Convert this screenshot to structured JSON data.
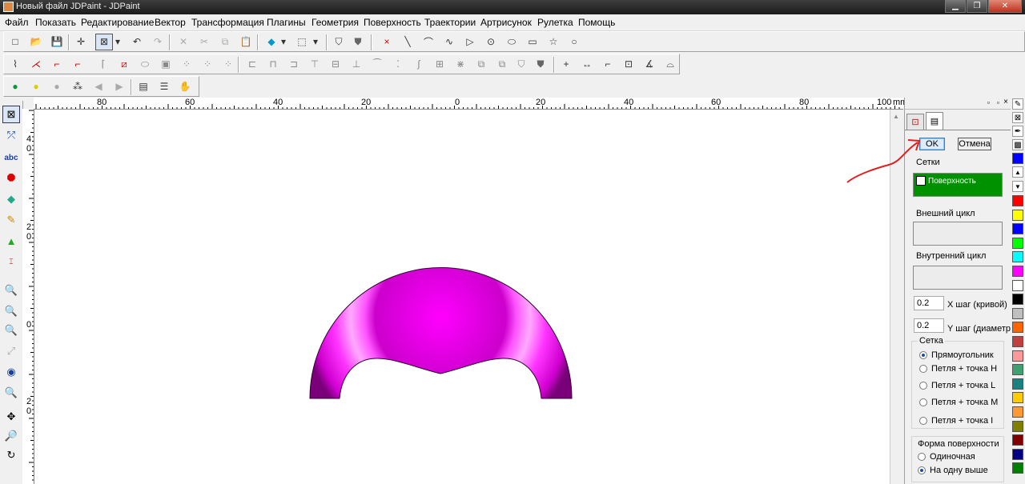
{
  "window": {
    "title": "Новый файл JDPaint - JDPaint",
    "minimize": "▁",
    "restore": "❐",
    "close": "✕"
  },
  "menu": [
    "Файл",
    "Показать",
    "Редактирование",
    "Вектор",
    "Трансформация",
    "Плагины",
    "Геометрия",
    "Поверхность",
    "Траектории",
    "Артрисунок",
    "Рулетка",
    "Помощь"
  ],
  "ruler": {
    "top_labels": [
      "80",
      "60",
      "40",
      "20",
      "0",
      "20",
      "40",
      "60",
      "80",
      "100",
      "mm"
    ],
    "left_labels": [
      "4",
      "0",
      "2",
      "0",
      "0",
      "2",
      "0"
    ]
  },
  "panel": {
    "ok_label": "OK",
    "cancel_label": "Отмена",
    "grids_label": "Сетки",
    "grid_item": "Поверхность",
    "outer_cycle_label": "Внешний цикл",
    "inner_cycle_label": "Внутренний цикл",
    "x_step_value": "0.2",
    "x_step_label": "X шаг (кривой)",
    "y_step_value": "0.2",
    "y_step_label": "Y шаг (диаметр)",
    "mesh_group_label": "Сетка",
    "mesh_options": [
      {
        "label": "Прямоугольник",
        "checked": true
      },
      {
        "label": "Петля + точка H",
        "checked": false
      },
      {
        "label": "Петля + точка L",
        "checked": false
      },
      {
        "label": "Петля + точка M",
        "checked": false
      },
      {
        "label": "Петля + точка I",
        "checked": false
      }
    ],
    "shape_group_label": "Форма поверхности",
    "shape_options": [
      {
        "label": "Одиночная",
        "checked": false
      },
      {
        "label": "На одну выше",
        "checked": true
      }
    ]
  },
  "colors": {
    "surface": "#ff00ff",
    "grid_item_bg": "#009100",
    "annotation_arrow": "#e02020",
    "palette": [
      "#0000ff",
      "#ff0000",
      "#ffff00",
      "#0000ff",
      "#00ff00",
      "#00ffff",
      "#ff00ff",
      "#ffffff",
      "#000000",
      "#c0c0c0",
      "#ff6600",
      "#c04040",
      "#ff9999",
      "#40a070",
      "#1a8080",
      "#ffcc00",
      "#ff9933",
      "#808000",
      "#800000",
      "#000080",
      "#008000"
    ]
  }
}
